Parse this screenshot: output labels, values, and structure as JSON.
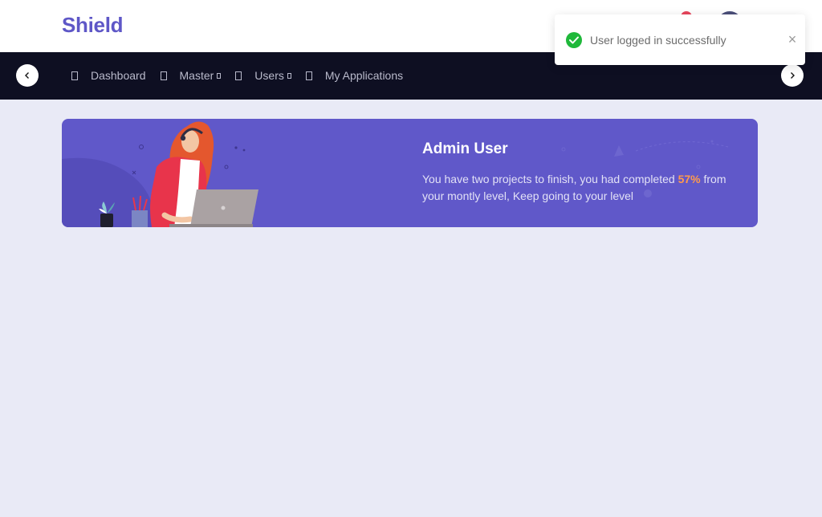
{
  "header": {
    "logo": "Shield"
  },
  "toast": {
    "message": "User logged in successfully",
    "close_icon": "close-icon",
    "status_icon": "check-circle-icon",
    "color": "#1fb83a"
  },
  "nav": {
    "items": [
      {
        "label": "Dashboard",
        "has_dropdown": false
      },
      {
        "label": "Master",
        "has_dropdown": true
      },
      {
        "label": "Users",
        "has_dropdown": true
      },
      {
        "label": "My Applications",
        "has_dropdown": false
      }
    ]
  },
  "banner": {
    "title": "Admin User",
    "text_before": "You have two projects to finish, you had completed ",
    "percent": "57%",
    "text_after": " from your montly level, Keep going to your level",
    "background": "#6058c9",
    "accent": "#ff9a4d"
  }
}
